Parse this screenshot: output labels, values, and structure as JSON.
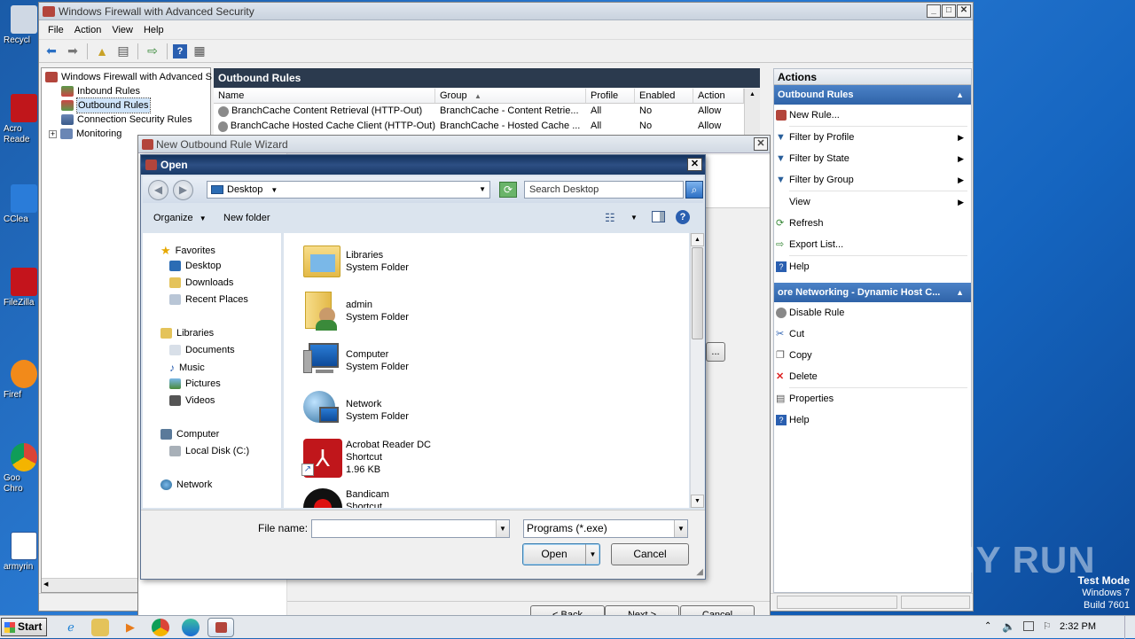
{
  "desktop": {
    "icons": [
      {
        "label": "Recycl",
        "color": "#cfd8e4"
      },
      {
        "label": "Acro Reade",
        "color": "#c0161b"
      },
      {
        "label": "CClea",
        "color": "#2a7cd9"
      },
      {
        "label": "FileZilla",
        "color": "#c4141c"
      },
      {
        "label": "Firef",
        "color": "#f28a1a"
      },
      {
        "label": "Goo Chro",
        "color": "#3b9a3b"
      },
      {
        "label": "armyrin",
        "color": "#ffffff"
      }
    ]
  },
  "mmc": {
    "title": "Windows Firewall with Advanced Security",
    "menu": [
      "File",
      "Action",
      "View",
      "Help"
    ],
    "tree": {
      "root": "Windows Firewall with Advanced S",
      "items": [
        "Inbound Rules",
        "Outbound Rules",
        "Connection Security Rules",
        "Monitoring"
      ]
    },
    "center_title": "Outbound Rules",
    "columns": [
      "Name",
      "Group",
      "Profile",
      "Enabled",
      "Action"
    ],
    "rows": [
      {
        "name": "BranchCache Content Retrieval (HTTP-Out)",
        "group": "BranchCache - Content Retrie...",
        "profile": "All",
        "enabled": "No",
        "action": "Allow"
      },
      {
        "name": "BranchCache Hosted Cache Client (HTTP-Out)",
        "group": "BranchCache - Hosted Cache ...",
        "profile": "All",
        "enabled": "No",
        "action": "Allow"
      }
    ],
    "actions": {
      "header": "Actions",
      "section1": "Outbound Rules",
      "section1_items": [
        "New Rule...",
        "Filter by Profile",
        "Filter by State",
        "Filter by Group",
        "View",
        "Refresh",
        "Export List...",
        "Help"
      ],
      "section2": "ore Networking - Dynamic Host C...",
      "section2_items": [
        "Disable Rule",
        "Cut",
        "Copy",
        "Delete",
        "Properties",
        "Help"
      ]
    }
  },
  "wizard": {
    "title": "New Outbound Rule Wizard",
    "browse_partial": "...",
    "back": "< Back",
    "next": "Next >",
    "cancel": "Cancel"
  },
  "open_dialog": {
    "title": "Open",
    "location": "Desktop",
    "search_placeholder": "Search Desktop",
    "organize": "Organize",
    "new_folder": "New folder",
    "nav": {
      "favorites": "Favorites",
      "fav_items": [
        "Desktop",
        "Downloads",
        "Recent Places"
      ],
      "libraries": "Libraries",
      "lib_items": [
        "Documents",
        "Music",
        "Pictures",
        "Videos"
      ],
      "computer": "Computer",
      "computer_items": [
        "Local Disk (C:)"
      ],
      "network": "Network"
    },
    "files": [
      {
        "name": "Libraries",
        "type": "System Folder",
        "size": ""
      },
      {
        "name": "admin",
        "type": "System Folder",
        "size": ""
      },
      {
        "name": "Computer",
        "type": "System Folder",
        "size": ""
      },
      {
        "name": "Network",
        "type": "System Folder",
        "size": ""
      },
      {
        "name": "Acrobat Reader DC",
        "type": "Shortcut",
        "size": "1.96 KB"
      },
      {
        "name": "Bandicam",
        "type": "Shortcut",
        "size": ""
      }
    ],
    "file_name_label": "File name:",
    "file_name_value": "",
    "filter": "Programs (*.exe)",
    "open_btn": "Open",
    "cancel_btn": "Cancel"
  },
  "taskbar": {
    "start": "Start",
    "time": "2:32 PM"
  },
  "watermark": {
    "text": "ANY RUN",
    "test_mode": "Test Mode",
    "os": "Windows 7",
    "build": "Build 7601"
  }
}
